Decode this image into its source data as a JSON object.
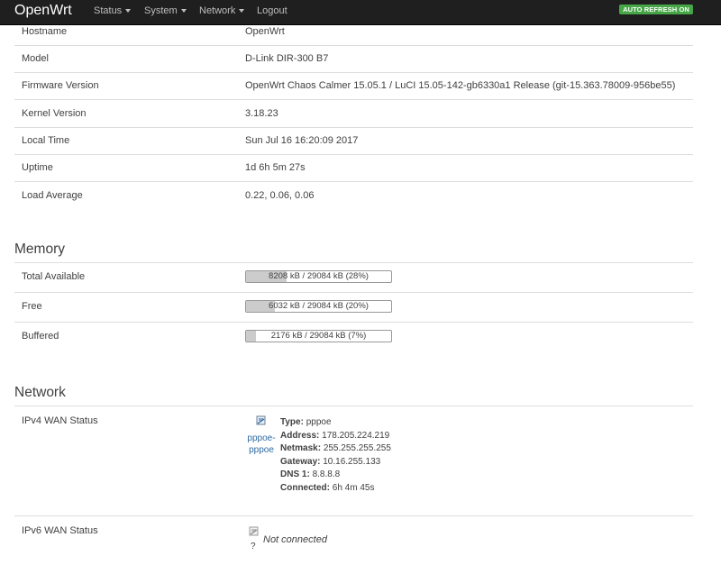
{
  "nav": {
    "brand": "OpenWrt",
    "items": [
      {
        "label": "Status",
        "dropdown": true
      },
      {
        "label": "System",
        "dropdown": true
      },
      {
        "label": "Network",
        "dropdown": true
      },
      {
        "label": "Logout",
        "dropdown": false
      }
    ],
    "auto_refresh": "AUTO REFRESH ON",
    "auto_refresh_color": "#46a546"
  },
  "system": [
    {
      "label": "Hostname",
      "value": "OpenWrt"
    },
    {
      "label": "Model",
      "value": "D-Link DIR-300 B7"
    },
    {
      "label": "Firmware Version",
      "value": "OpenWrt Chaos Calmer 15.05.1 / LuCI 15.05-142-gb6330a1 Release (git-15.363.78009-956be55)"
    },
    {
      "label": "Kernel Version",
      "value": "3.18.23"
    },
    {
      "label": "Local Time",
      "value": "Sun Jul 16 16:20:09 2017"
    },
    {
      "label": "Uptime",
      "value": "1d 6h 5m 27s"
    },
    {
      "label": "Load Average",
      "value": "0.22, 0.06, 0.06"
    }
  ],
  "memory": {
    "title": "Memory",
    "rows": [
      {
        "label": "Total Available",
        "text": "8208 kB / 29084 kB (28%)",
        "percent": 28
      },
      {
        "label": "Free",
        "text": "6032 kB / 29084 kB (20%)",
        "percent": 20
      },
      {
        "label": "Buffered",
        "text": "2176 kB / 29084 kB (7%)",
        "percent": 7
      }
    ]
  },
  "network": {
    "title": "Network",
    "ipv4": {
      "label": "IPv4 WAN Status",
      "iface_line1": "pppoe-",
      "iface_line2": "pppoe",
      "type_label": "Type:",
      "type": "pppoe",
      "address_label": "Address:",
      "address": "178.205.224.219",
      "netmask_label": "Netmask:",
      "netmask": "255.255.255.255",
      "gateway_label": "Gateway:",
      "gateway": "10.16.255.133",
      "dns_label": "DNS 1:",
      "dns": "8.8.8.8",
      "connected_label": "Connected:",
      "connected": "6h 4m 45s"
    },
    "ipv6": {
      "label": "IPv6 WAN Status",
      "icon_text": "?",
      "status": "Not connected"
    }
  }
}
